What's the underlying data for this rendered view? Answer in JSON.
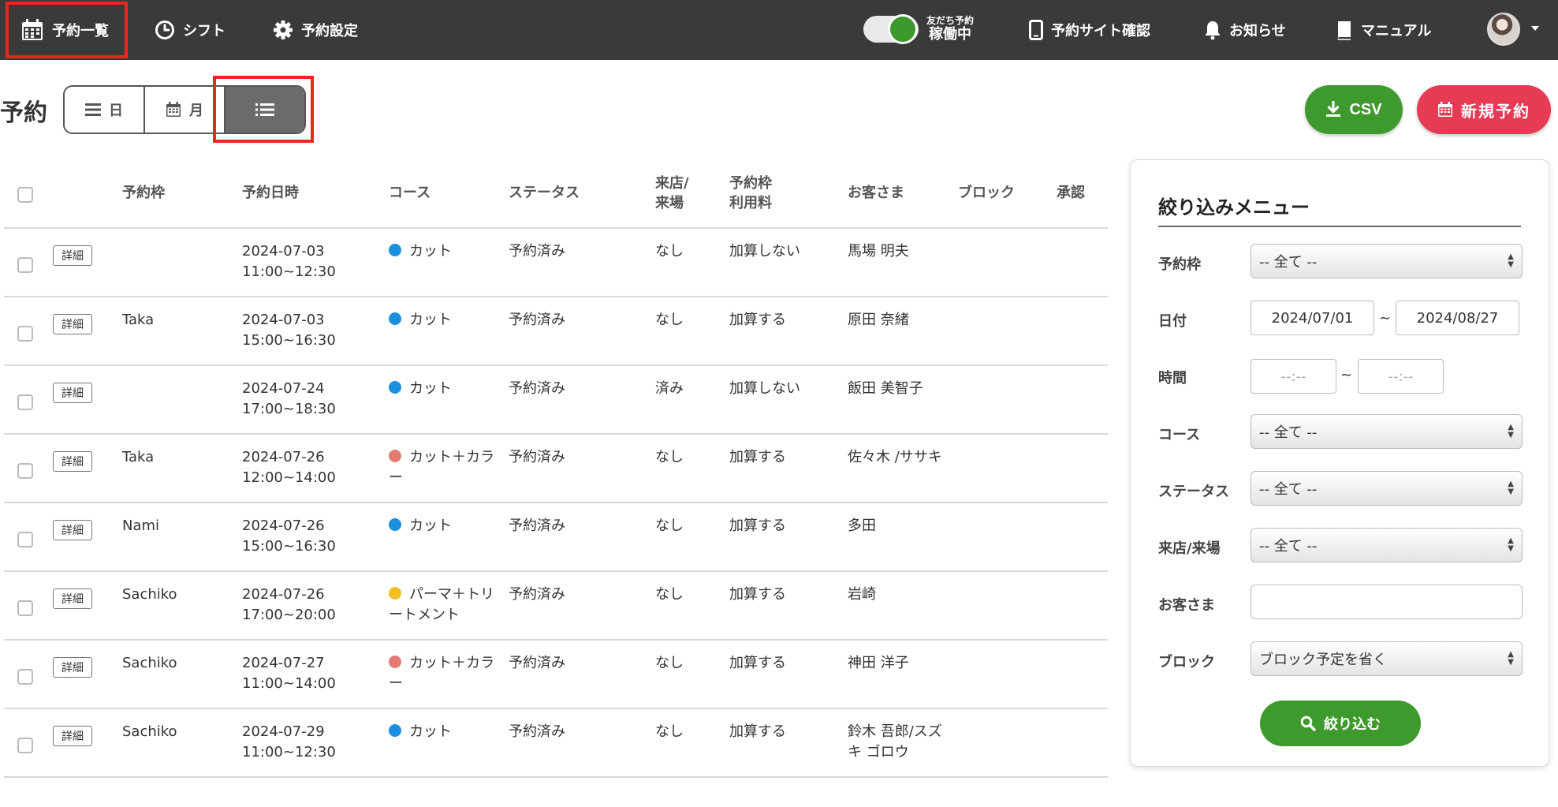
{
  "nav": {
    "items": [
      {
        "label": "予約一覧",
        "icon": "calendar-icon"
      },
      {
        "label": "シフト",
        "icon": "clock-icon"
      },
      {
        "label": "予約設定",
        "icon": "gear-icon"
      }
    ],
    "toggle": {
      "line1": "友だち予約",
      "line2": "稼働中",
      "on": true
    },
    "right_items": [
      {
        "label": "予約サイト確認",
        "icon": "smartphone-icon"
      },
      {
        "label": "お知らせ",
        "icon": "bell-icon"
      },
      {
        "label": "マニュアル",
        "icon": "book-icon"
      }
    ]
  },
  "page": {
    "title": "予約",
    "view_switch": [
      {
        "label": "日",
        "icon": "list-lines-icon"
      },
      {
        "label": "月",
        "icon": "calendar-icon"
      },
      {
        "label": "",
        "icon": "list-bullet-icon",
        "active": true
      }
    ],
    "csv_label": "CSV",
    "new_label": "新規予約"
  },
  "table": {
    "headers": {
      "slot": "予約枠",
      "datetime": "予約日時",
      "course": "コース",
      "status": "ステータス",
      "visit_line1": "来店/",
      "visit_line2": "来場",
      "fee_line1": "予約枠",
      "fee_line2": "利用料",
      "customer": "お客さま",
      "block": "ブロック",
      "approve": "承認"
    },
    "detail_label": "詳細",
    "rows": [
      {
        "slot": "",
        "date": "2024-07-03",
        "time": "11:00~12:30",
        "course": "カット",
        "course_color": "#1a8fe0",
        "status": "予約済み",
        "visit": "なし",
        "fee": "加算しない",
        "customer": "馬場 明夫"
      },
      {
        "slot": "Taka",
        "date": "2024-07-03",
        "time": "15:00~16:30",
        "course": "カット",
        "course_color": "#1a8fe0",
        "status": "予約済み",
        "visit": "なし",
        "fee": "加算する",
        "customer": "原田 奈緒"
      },
      {
        "slot": "",
        "date": "2024-07-24",
        "time": "17:00~18:30",
        "course": "カット",
        "course_color": "#1a8fe0",
        "status": "予約済み",
        "visit": "済み",
        "fee": "加算しない",
        "customer": "飯田 美智子"
      },
      {
        "slot": "Taka",
        "date": "2024-07-26",
        "time": "12:00~14:00",
        "course": "カット＋カラー",
        "course_color": "#e57a72",
        "status": "予約済み",
        "visit": "なし",
        "fee": "加算する",
        "customer": "佐々木 /ササキ"
      },
      {
        "slot": "Nami",
        "date": "2024-07-26",
        "time": "15:00~16:30",
        "course": "カット",
        "course_color": "#1a8fe0",
        "status": "予約済み",
        "visit": "なし",
        "fee": "加算する",
        "customer": "多田"
      },
      {
        "slot": "Sachiko",
        "date": "2024-07-26",
        "time": "17:00~20:00",
        "course": "パーマ＋トリートメント",
        "course_color": "#f2be22",
        "status": "予約済み",
        "visit": "なし",
        "fee": "加算する",
        "customer": "岩崎"
      },
      {
        "slot": "Sachiko",
        "date": "2024-07-27",
        "time": "11:00~14:00",
        "course": "カット＋カラー",
        "course_color": "#e57a72",
        "status": "予約済み",
        "visit": "なし",
        "fee": "加算する",
        "customer": "神田 洋子"
      },
      {
        "slot": "Sachiko",
        "date": "2024-07-29",
        "time": "11:00~12:30",
        "course": "カット",
        "course_color": "#1a8fe0",
        "status": "予約済み",
        "visit": "なし",
        "fee": "加算する",
        "customer": "鈴木 吾郎/スズキ ゴロウ"
      }
    ]
  },
  "filter": {
    "title": "絞り込みメニュー",
    "slot_label": "予約枠",
    "slot_value": "-- 全て --",
    "date_label": "日付",
    "date_from": "2024/07/01",
    "date_to": "2024/08/27",
    "range_sep": "~",
    "time_label": "時間",
    "time_placeholder": "--:--",
    "course_label": "コース",
    "course_value": "-- 全て --",
    "status_label": "ステータス",
    "status_value": "-- 全て --",
    "visit_label": "来店/来場",
    "visit_value": "-- 全て --",
    "customer_label": "お客さま",
    "customer_value": "",
    "block_label": "ブロック",
    "block_value": "ブロック予定を省く",
    "submit_label": "絞り込む"
  }
}
